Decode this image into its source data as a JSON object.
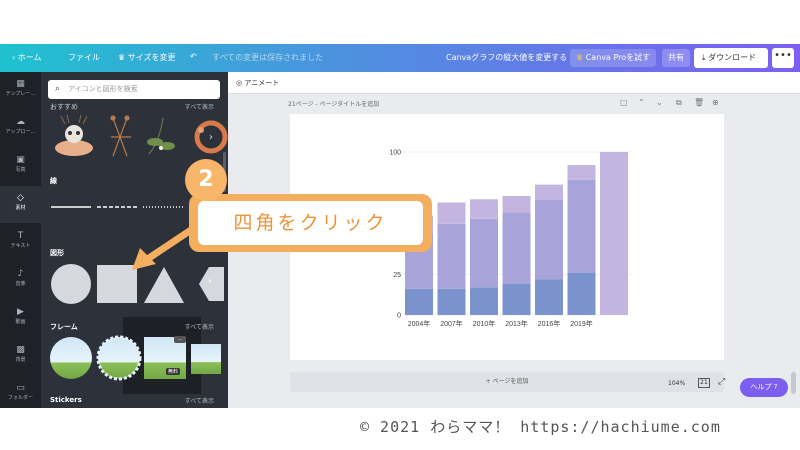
{
  "topbar": {
    "home": "ホーム",
    "file": "ファイル",
    "resize": "サイズを変更",
    "saved_status": "すべての変更は保存されました",
    "doc_title": "Canvaグラフの縦大値を変更する",
    "pro_button": "Canva Proを試す",
    "share_button": "共有",
    "download_button": "ダウンロード",
    "more_button": "•••"
  },
  "rail": [
    {
      "label": "テンプレー…",
      "icon": "template-icon"
    },
    {
      "label": "アップロー…",
      "icon": "upload-icon"
    },
    {
      "label": "写真",
      "icon": "photo-icon"
    },
    {
      "label": "素材",
      "icon": "elements-icon"
    },
    {
      "label": "テキスト",
      "icon": "text-icon"
    },
    {
      "label": "音楽",
      "icon": "music-icon"
    },
    {
      "label": "動画",
      "icon": "video-icon"
    },
    {
      "label": "背景",
      "icon": "background-icon"
    },
    {
      "label": "フォルダー",
      "icon": "folder-icon"
    }
  ],
  "panel": {
    "search_placeholder": "アイコンと図形を検索",
    "sections": {
      "recommended": "おすすめ",
      "lines": "線",
      "shapes": "図形",
      "frames": "フレーム",
      "stickers": "Stickers"
    },
    "see_all": "すべて表示",
    "free_badge": "無料"
  },
  "canvas": {
    "animate": "アニメート",
    "page_label": "21ページ - ページタイトルを追加",
    "add_page": "+ ページを追加",
    "zoom": "104%",
    "page_count": "21",
    "help": "ヘルプ ?"
  },
  "annotation": {
    "step": "2",
    "text": "四角をクリック"
  },
  "footer": "©  2021 わらママ！ https://hachiume.com",
  "chart_data": {
    "type": "bar",
    "stacked": true,
    "categories": [
      "2004年",
      "2007年",
      "2010年",
      "2013年",
      "2016年",
      "2019年",
      ""
    ],
    "series": [
      {
        "values": [
          16,
          16,
          17,
          19,
          22,
          26,
          0
        ],
        "color": "#7b93cc"
      },
      {
        "values": [
          34,
          40,
          42,
          44,
          49,
          57,
          0
        ],
        "color": "#a8a4da"
      },
      {
        "values": [
          11,
          13,
          12,
          10,
          9,
          9,
          100
        ],
        "color": "#c4b5e0"
      }
    ],
    "yticks": [
      0,
      25,
      100
    ],
    "ylim": [
      0,
      100
    ]
  }
}
